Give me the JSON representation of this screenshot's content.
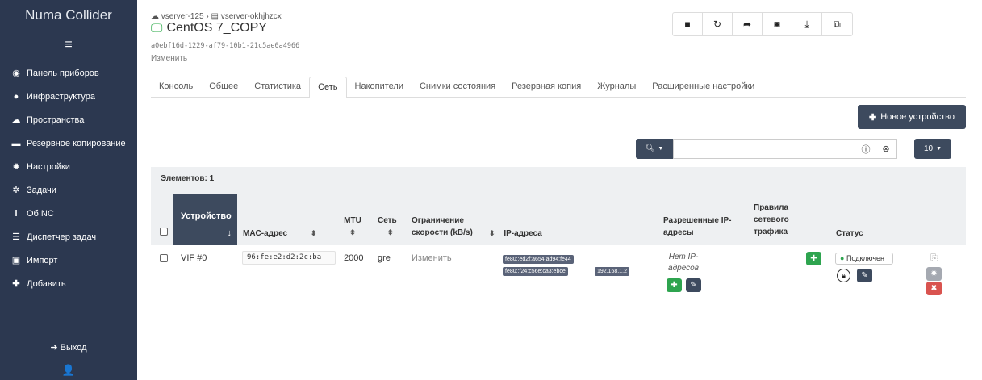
{
  "app": {
    "brand": "Numa Collider",
    "menu_icon": "≡"
  },
  "sidebar": {
    "items": [
      {
        "label": "Панель приборов",
        "icon": "dashboard-icon"
      },
      {
        "label": "Инфраструктура",
        "icon": "globe-icon"
      },
      {
        "label": "Пространства",
        "icon": "cloud-icon"
      },
      {
        "label": "Резервное копирование",
        "icon": "archive-icon"
      },
      {
        "label": "Настройки",
        "icon": "gear-icon"
      },
      {
        "label": "Задачи",
        "icon": "gears-icon"
      },
      {
        "label": "Об NC",
        "icon": "info-icon"
      },
      {
        "label": "Диспетчер задач",
        "icon": "tasks-icon"
      },
      {
        "label": "Импорт",
        "icon": "import-icon"
      },
      {
        "label": "Добавить",
        "icon": "plus-icon"
      }
    ],
    "logout_label": "Выход"
  },
  "header": {
    "breadcrumb": {
      "pool": "vserver-125",
      "host": "vserver-okhjhzcx"
    },
    "vm_name": "CentOS 7_COPY",
    "uuid": "a0ebf16d-1229-af79-10b1-21c5ae0a4966",
    "edit_label": "Изменить",
    "toolbar": [
      "stop-icon",
      "restart-icon",
      "migrate-icon",
      "snapshot-icon",
      "export-icon",
      "copy-icon"
    ]
  },
  "tabs": [
    {
      "label": "Консоль",
      "active": false
    },
    {
      "label": "Общее",
      "active": false
    },
    {
      "label": "Статистика",
      "active": false
    },
    {
      "label": "Сеть",
      "active": true
    },
    {
      "label": "Накопители",
      "active": false
    },
    {
      "label": "Снимки состояния",
      "active": false
    },
    {
      "label": "Резервная копия",
      "active": false
    },
    {
      "label": "Журналы",
      "active": false
    },
    {
      "label": "Расширенные настройки",
      "active": false
    }
  ],
  "controls": {
    "new_device_label": "Новое устройство",
    "search_placeholder": "",
    "page_size": "10"
  },
  "table": {
    "count_label": "Элементов: 1",
    "headers": {
      "device": "Устройство",
      "mac": "MAC-адрес",
      "mtu": "MTU",
      "network": "Сеть",
      "rate_limit": "Ограничение скорости (kB/s)",
      "ips": "IP-адреса",
      "allowed_ips": "Разрешенные IP-адресы",
      "rules": "Правила сетевого трафика",
      "status": "Статус"
    },
    "rows": [
      {
        "device": "VIF #0",
        "mac": "96:fe:e2:d2:2c:ba",
        "mtu": "2000",
        "network": "gre",
        "rate_limit": "Изменить",
        "ips": [
          "fe80::ed2f:a654:ad94:fe44",
          "fe80::f24:c56e:ca3:ebce",
          "192.168.1.2"
        ],
        "allowed_ips": "Нет IP-адресов",
        "status": "Подключен"
      }
    ]
  },
  "colors": {
    "sidebar": "#2c3850",
    "accent_dark": "#3d4a5e",
    "success": "#2ea44f",
    "danger": "#d9534f"
  }
}
